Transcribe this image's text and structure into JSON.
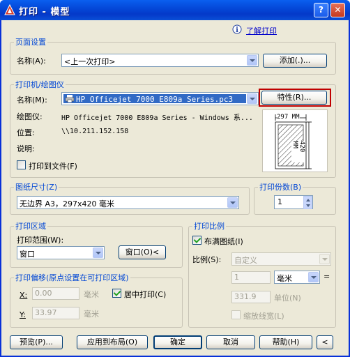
{
  "window": {
    "title": "打印 - 模型",
    "help_btn": "?",
    "close_btn": "✕"
  },
  "help_link": "了解打印",
  "page_setup": {
    "title": "页面设置",
    "name_label": "名称(A):",
    "name_value": "<上一次打印>",
    "add_button": "添加(.)..."
  },
  "printer": {
    "title": "打印机/绘图仪",
    "name_label": "名称(M):",
    "name_value": "HP Officejet 7000 E809a Series.pc3",
    "properties_button": "特性(R)...",
    "plotter_label": "绘图仪:",
    "plotter_value": "HP Officejet 7000 E809a Series - Windows 系...",
    "location_label": "位置:",
    "location_value": "\\\\10.211.152.158",
    "description_label": "说明:",
    "print_to_file_label": "打印到文件(F)",
    "preview_width": "297 MM",
    "preview_height": "420 MM"
  },
  "paper_size": {
    "title": "图纸尺寸(Z)",
    "value": "无边界 A3，297x420 毫米"
  },
  "copies": {
    "title": "打印份数(B)",
    "value": "1"
  },
  "plot_area": {
    "title": "打印区域",
    "range_label": "打印范围(W):",
    "range_value": "窗口",
    "window_button": "窗口(O)<"
  },
  "plot_scale": {
    "title": "打印比例",
    "fit_label": "布满图纸(I)",
    "scale_label": "比例(S):",
    "scale_value": "自定义",
    "value1": "1",
    "unit_value": "毫米",
    "equals": "=",
    "value2": "331.9",
    "unit_label": "单位(N)",
    "lineweight_label": "缩放线宽(L)"
  },
  "plot_offset": {
    "title": "打印偏移(原点设置在可打印区域)",
    "x_label": "X:",
    "x_value": "0.00",
    "x_unit": "毫米",
    "y_label": "Y:",
    "y_value": "33.97",
    "y_unit": "毫米",
    "center_label": "居中打印(C)"
  },
  "footer": {
    "preview": "预览(P)...",
    "apply": "应用到布局(O)",
    "ok": "确定",
    "cancel": "取消",
    "help": "帮助(H)",
    "more": "<"
  },
  "colors": {
    "highlight_box": "#C00000",
    "title_blue": "#0046D5",
    "selection": "#316AC5"
  }
}
